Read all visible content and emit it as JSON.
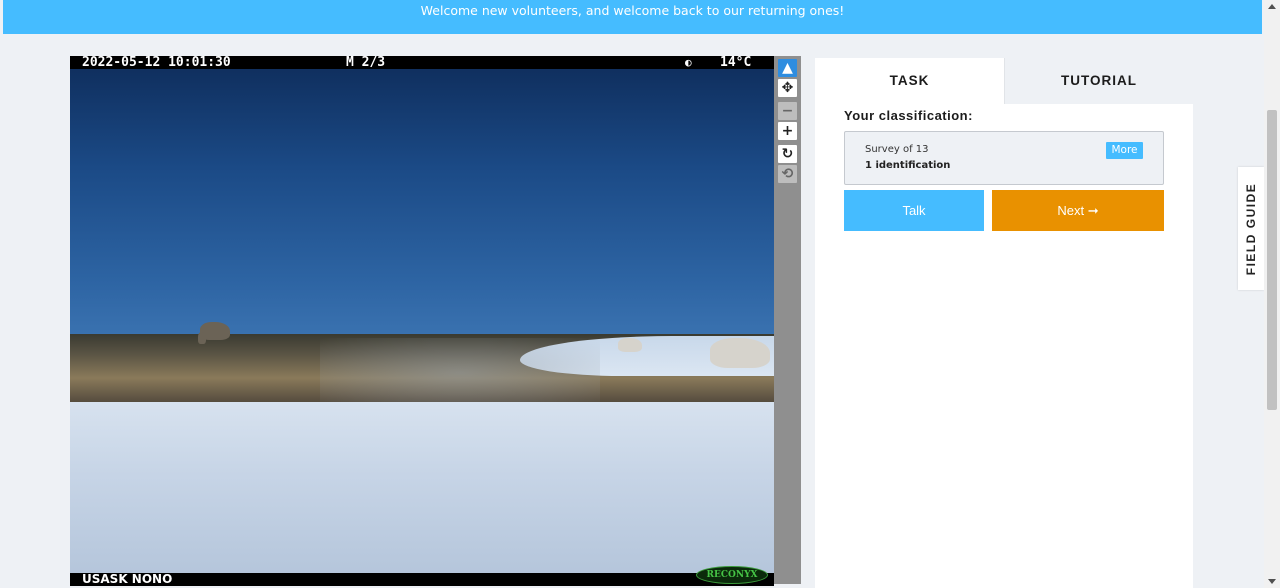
{
  "banner": {
    "text": "Welcome new volunteers, and welcome back to our returning ones!"
  },
  "camera": {
    "timestamp": "2022-05-12 10:01:30",
    "sequence": "M 2/3",
    "moon_icon": "moon-phase-icon",
    "temperature": "14°C",
    "site": "USASK NONO",
    "brand": "RECONYX"
  },
  "toolbar": {
    "select": "▲",
    "pan": "✥",
    "zoom_out": "−",
    "zoom_in": "+",
    "rotate": "↻",
    "reset": "⟲"
  },
  "tabs": {
    "task": "TASK",
    "tutorial": "TUTORIAL"
  },
  "classification": {
    "heading": "Your classification:",
    "survey": "Survey of 13",
    "count": "1 identification",
    "more": "More"
  },
  "buttons": {
    "talk": "Talk",
    "next": "Next ➞"
  },
  "field_guide": {
    "label": "FIELD GUIDE"
  },
  "colors": {
    "accent": "#45bcff",
    "next": "#e99100"
  }
}
